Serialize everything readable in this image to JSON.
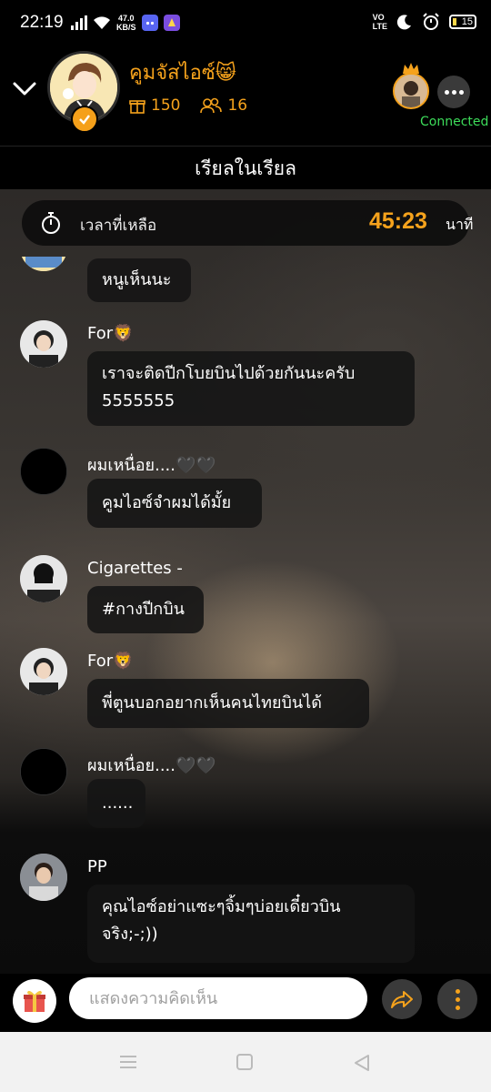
{
  "status_bar": {
    "time": "22:19",
    "speed_value": "47.0",
    "speed_unit": "KB/S",
    "volte": "VO",
    "lte": "LTE",
    "battery": "15"
  },
  "header": {
    "host_name": "คูมจัสไอซ์😸",
    "gifts_count": "150",
    "listeners_count": "16",
    "connection_status": "Connected",
    "accent_color": "#f5a21c",
    "connected_color": "#3ddc5a"
  },
  "room": {
    "title": "เรียลในเรียล"
  },
  "timer": {
    "label": "เวลาที่เหลือ",
    "value": "45:23",
    "unit": "นาที"
  },
  "chat": {
    "messages": [
      {
        "user": "",
        "text": "หนูเห็นนะ"
      },
      {
        "user": "For🦁",
        "text_line1": "เราจะติดปีกโบยบินไปด้วยกันนะครับ",
        "text_line2": "5555555"
      },
      {
        "user": "ผมเหนื่อย....🖤🖤",
        "text": "คูมไอซ์จำผมได้มั้ย"
      },
      {
        "user": "Cigarettes -",
        "text": "#กางปีกบิน"
      },
      {
        "user": "For🦁",
        "text": "พี่ตูนบอกอยากเห็นคนไทยบินได้"
      },
      {
        "user": "ผมเหนื่อย....🖤🖤",
        "text": "......"
      },
      {
        "user": "PP",
        "text_line1": "คุณไอซ์อย่าแซะๆจิ้มๆบ่อยเดี๋ยวบิน",
        "text_line2": "จริง;-;))"
      }
    ]
  },
  "bottom_bar": {
    "comment_placeholder": "แสดงความคิดเห็น"
  },
  "icons": {
    "back": "chevron-down-icon",
    "gift": "gift-icon",
    "listeners": "people-icon",
    "timer": "stopwatch-icon",
    "share": "share-arrow-icon",
    "more": "more-dots-icon",
    "gift_box": "gift-box-icon"
  }
}
